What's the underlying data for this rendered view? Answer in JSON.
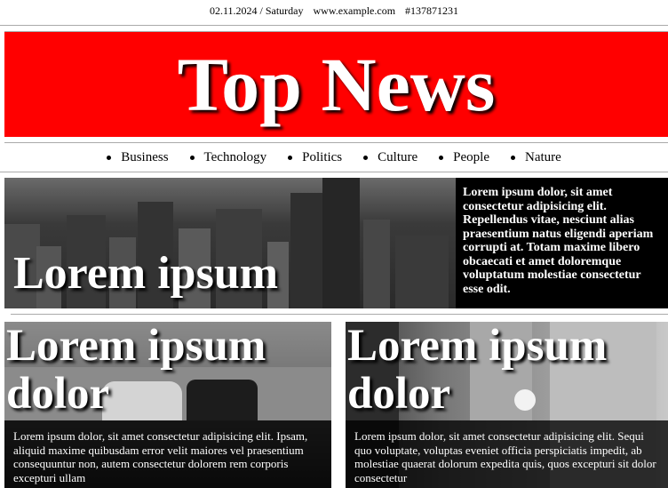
{
  "topline": {
    "date": "02.11.2024 / Saturday",
    "site": "www.example.com",
    "issue": "#137871231"
  },
  "masthead": {
    "title": "Top News",
    "bg_color": "#ff0000"
  },
  "nav": {
    "items": [
      "Business",
      "Technology",
      "Politics",
      "Culture",
      "People",
      "Nature"
    ]
  },
  "feature": {
    "title": "Lorem ipsum",
    "text": "Lorem ipsum dolor, sit amet consectetur adipisicing elit. Repellendus vitae, nesciunt alias praesentium natus eligendi aperiam corrupti at. Totam maxime libero obcaecati et amet doloremque voluptatum molestiae consectetur esse odit."
  },
  "cards": [
    {
      "title": "Lorem ipsum dolor",
      "text": "Lorem ipsum dolor, sit amet consectetur adipisicing elit. Ipsam, aliquid maxime quibusdam error velit maiores vel praesentium consequuntur non, autem consectetur dolorem rem corporis excepturi ullam"
    },
    {
      "title": "Lorem ipsum dolor",
      "text": "Lorem ipsum dolor, sit amet consectetur adipisicing elit. Sequi quo voluptate, voluptas eveniet officia perspiciatis impedit, ab molestiae quaerat dolorum expedita quis, quos excepturi sit dolor consectetur"
    }
  ]
}
